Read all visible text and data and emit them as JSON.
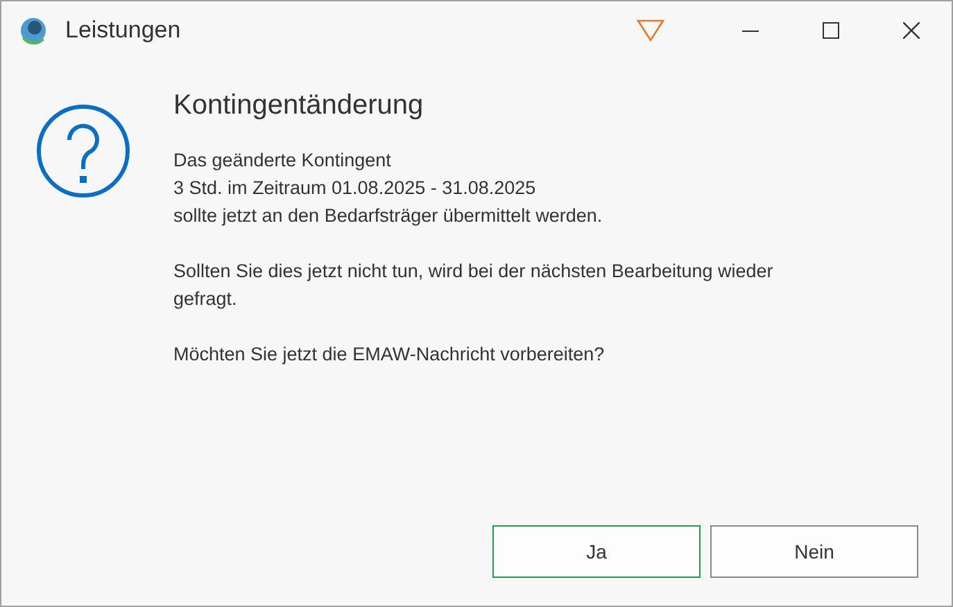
{
  "window": {
    "title": "Leistungen"
  },
  "dialog": {
    "heading": "Kontingentänderung",
    "paragraphs": [
      [
        "Das geänderte Kontingent",
        "3 Std. im Zeitraum 01.08.2025 - 31.08.2025",
        "sollte jetzt an den Bedarfsträger übermittelt werden."
      ],
      [
        "Sollten Sie dies jetzt nicht tun, wird bei der nächsten Bearbeitung wieder",
        "gefragt."
      ],
      [
        "Möchten Sie jetzt die EMAW-Nachricht vorbereiten?"
      ]
    ]
  },
  "buttons": [
    {
      "label": "Ja",
      "default": true
    },
    {
      "label": "Nein",
      "default": false
    }
  ]
}
